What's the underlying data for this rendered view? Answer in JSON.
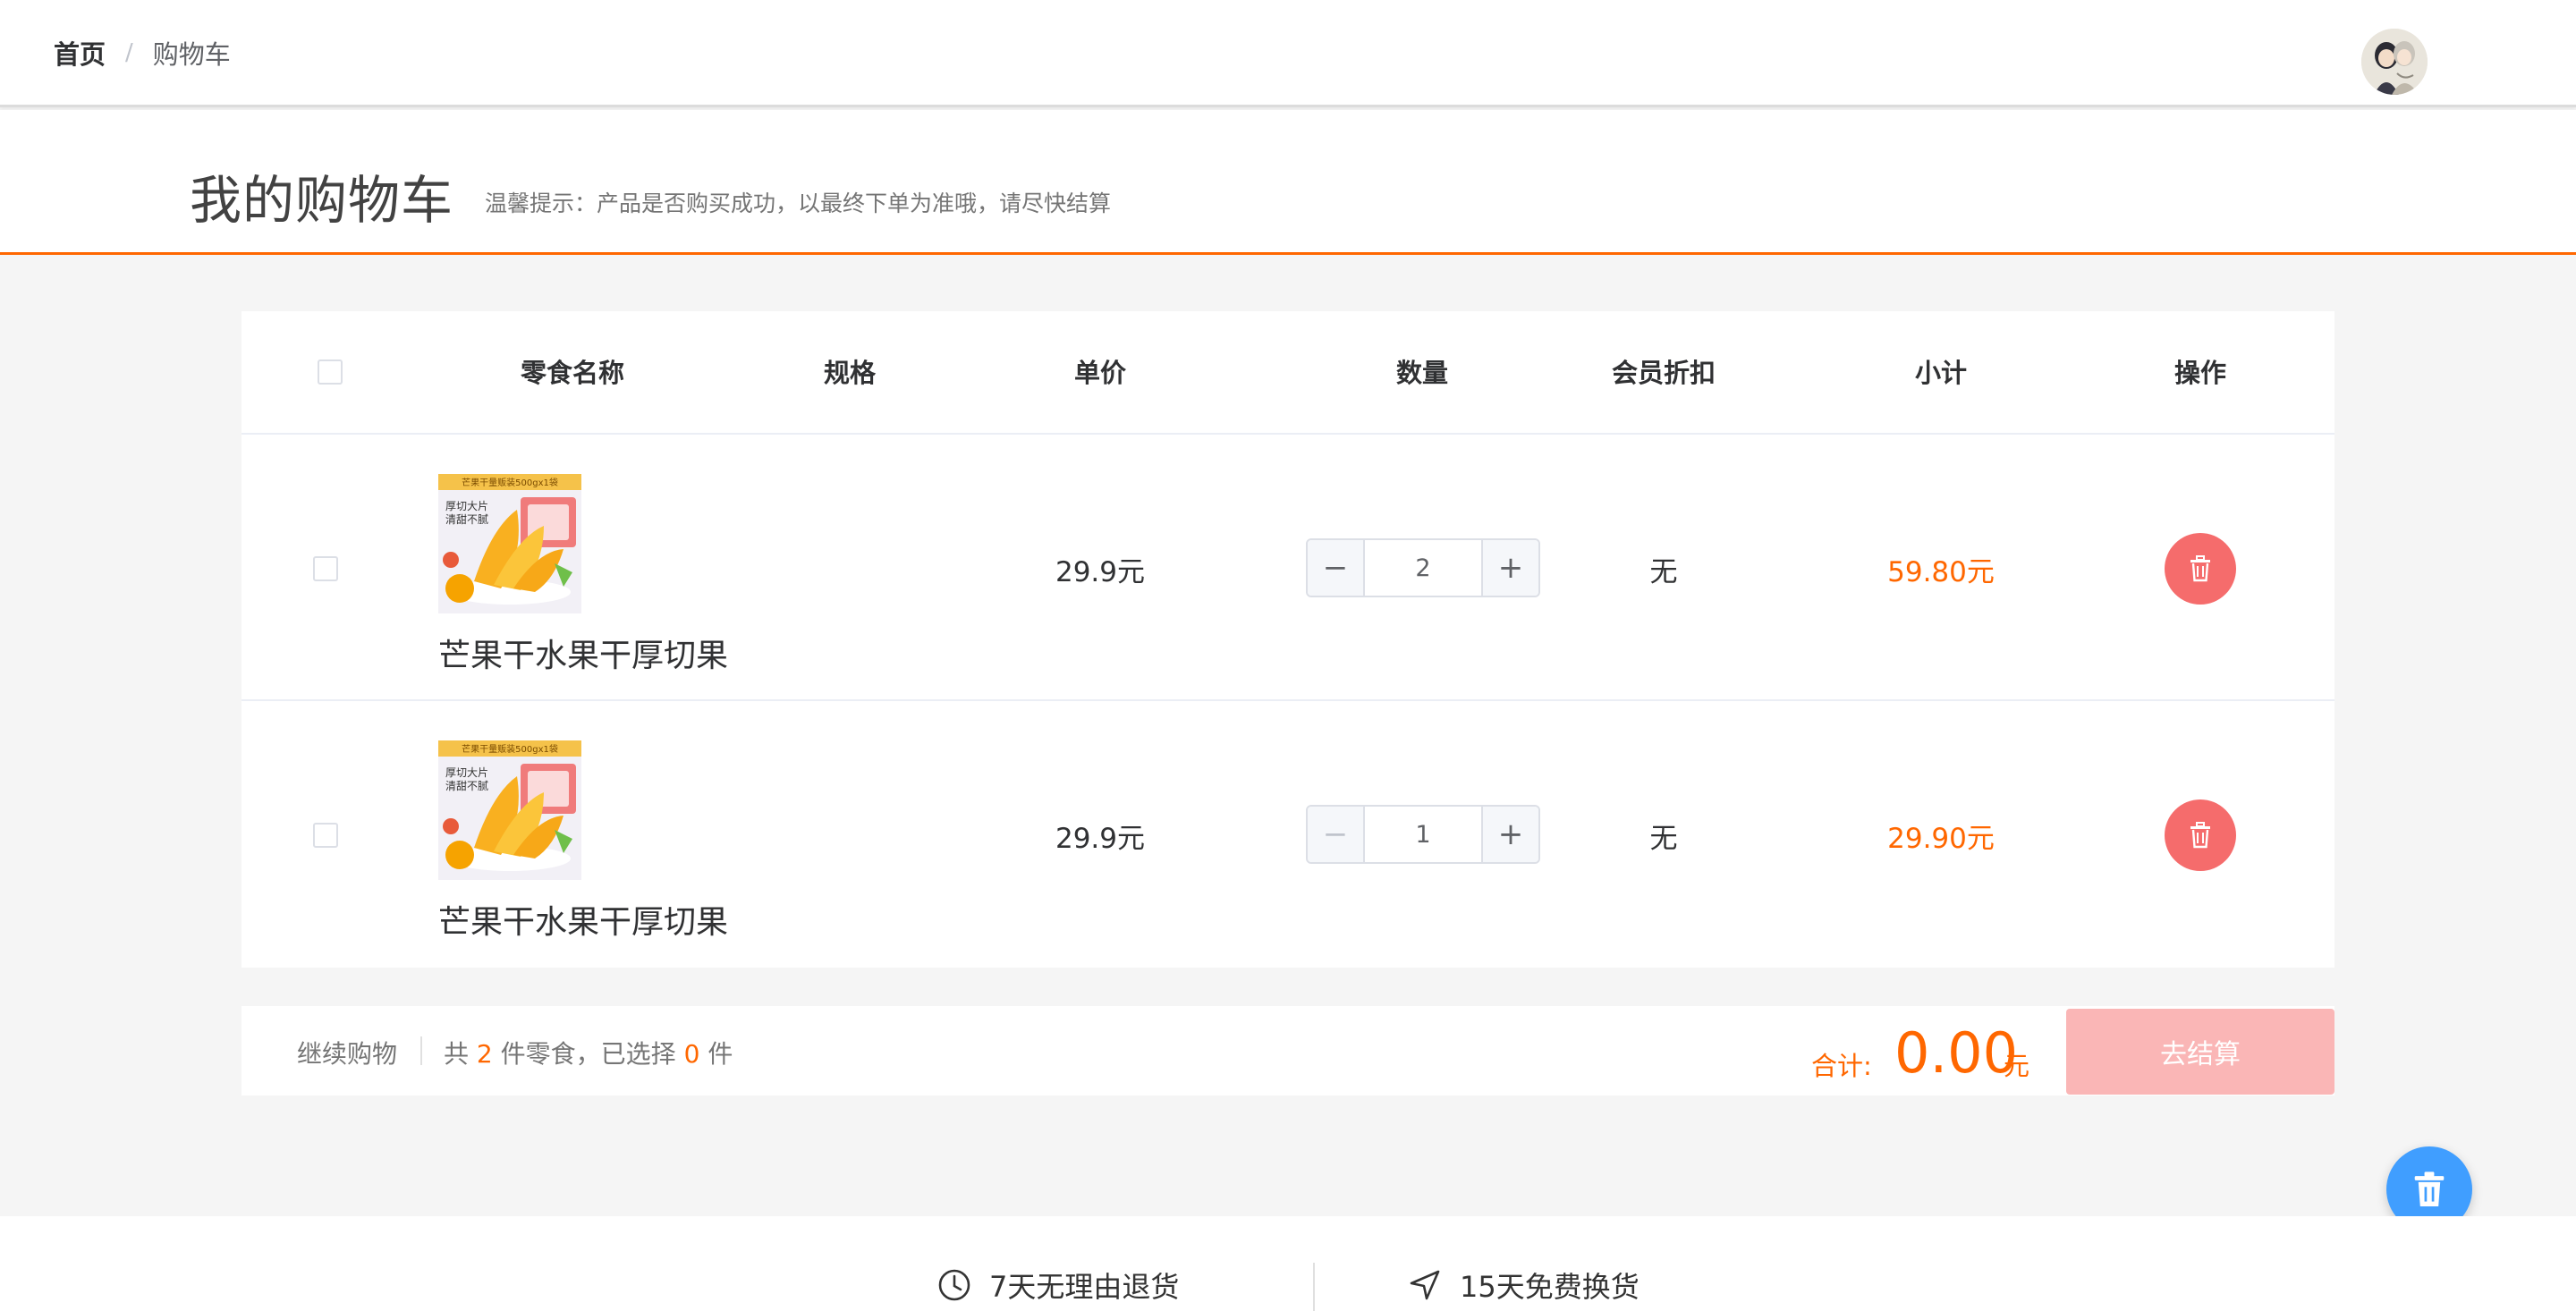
{
  "breadcrumb": {
    "home": "首页",
    "separator": "/",
    "current": "购物车"
  },
  "header": {
    "title": "我的购物车",
    "tip": "温馨提示：产品是否购买成功，以最终下单为准哦，请尽快结算"
  },
  "table": {
    "columns": {
      "name": "零食名称",
      "spec": "规格",
      "price": "单价",
      "quantity": "数量",
      "discount": "会员折扣",
      "subtotal": "小计",
      "action": "操作"
    },
    "rows": [
      {
        "name": "芒果干水果干厚切果",
        "price": "29.9元",
        "quantity": "2",
        "discount": "无",
        "subtotal": "59.80元",
        "minus_symbol": "−",
        "plus_symbol": "+"
      },
      {
        "name": "芒果干水果干厚切果",
        "price": "29.9元",
        "quantity": "1",
        "discount": "无",
        "subtotal": "29.90元",
        "minus_symbol": "−",
        "plus_symbol": "+"
      }
    ],
    "product_image": {
      "banner": "芒果干量贩装500gx1袋",
      "line1": "厚切大片",
      "line2": "清甜不腻"
    }
  },
  "footer_bar": {
    "continue": "继续购物",
    "count_prefix": "共",
    "total_count": "2",
    "count_middle": "件零食，已选择",
    "selected_count": "0",
    "count_suffix": "件",
    "total_label": "合计:",
    "total_value": "0.00",
    "total_unit": "元",
    "checkout": "去结算"
  },
  "service": [
    {
      "icon": "clock-icon",
      "label": "7天无理由退货"
    },
    {
      "icon": "navigation-arrow-icon",
      "label": "15天免费换货"
    }
  ],
  "colors": {
    "accent": "#ff6700",
    "delete": "#f56c6c",
    "checkout_disabled": "#fab6b6",
    "float_button": "#409eff"
  }
}
